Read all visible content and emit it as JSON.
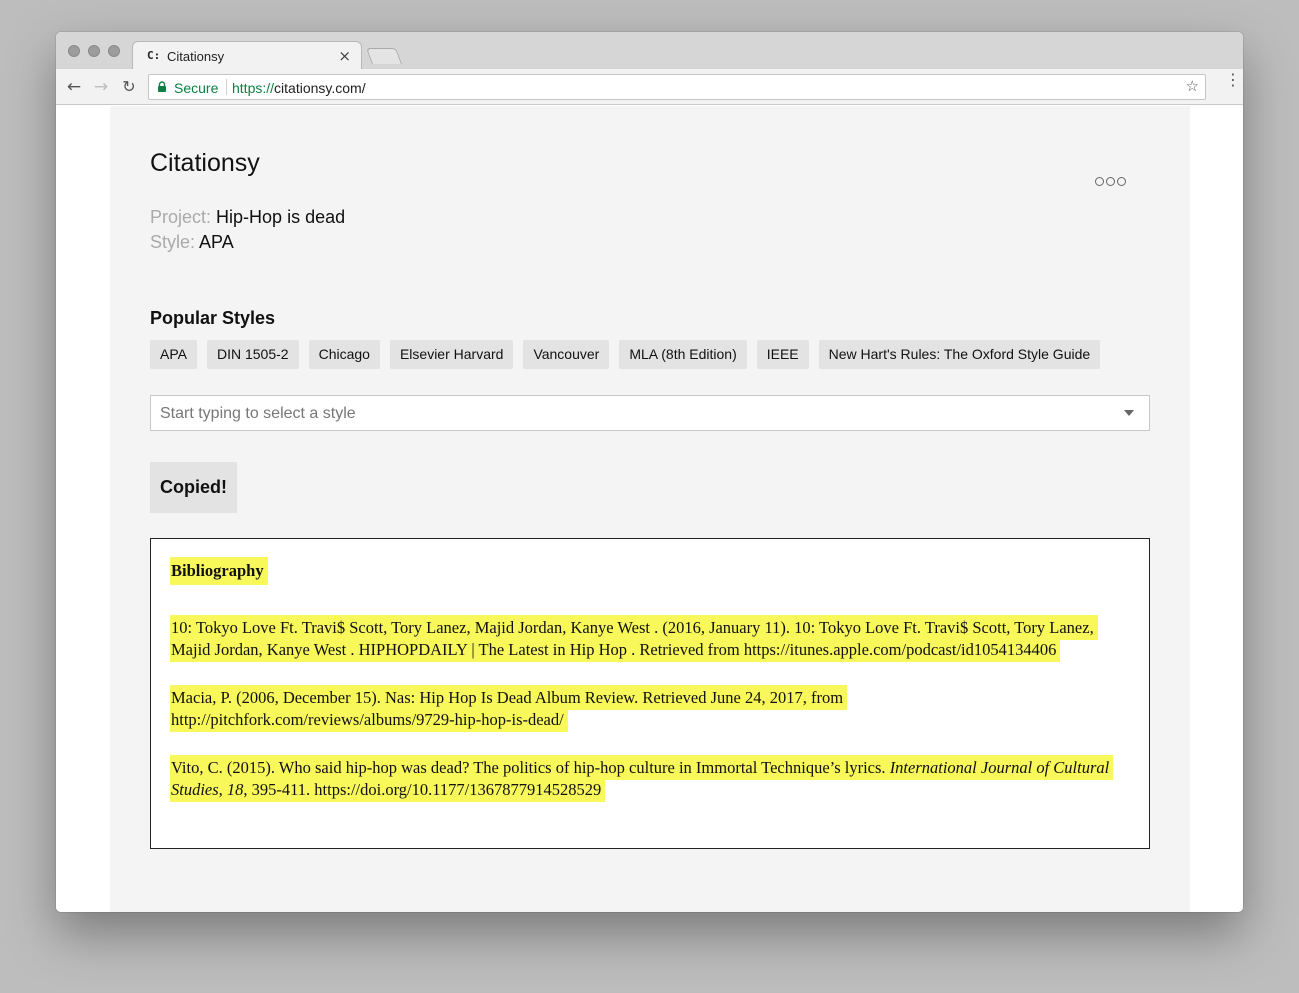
{
  "browser": {
    "tab_title": "Citationsy",
    "tab_favicon": "C:",
    "tab_close": "×",
    "secure_label": "Secure",
    "url_scheme": "https://",
    "url_rest": "citationsy.com/"
  },
  "icons": {
    "back": "←",
    "forward": "→",
    "reload": "↻",
    "star": "☆",
    "menu": "⋮"
  },
  "app": {
    "title": "Citationsy",
    "project_key": "Project:",
    "project_value": "Hip-Hop is dead",
    "style_key": "Style:",
    "style_value": "APA"
  },
  "popular": {
    "title": "Popular Styles",
    "styles": [
      "APA",
      "DIN 1505-2",
      "Chicago",
      "Elsevier Harvard",
      "Vancouver",
      "MLA (8th Edition)",
      "IEEE",
      "New Hart's Rules: The Oxford Style Guide"
    ]
  },
  "style_select": {
    "placeholder": "Start typing to select a style"
  },
  "copy_button": {
    "label": "Copied!"
  },
  "bibliography": {
    "heading": "Bibliography",
    "entries": [
      {
        "text": "10: Tokyo Love Ft. Travi$ Scott, Tory Lanez, Majid Jordan, Kanye West . (2016, January 11). 10: Tokyo Love Ft. Travi$ Scott, Tory Lanez, Majid Jordan, Kanye West . HIPHOPDAILY | The Latest in Hip Hop . Retrieved from https://itunes.apple.com/podcast/id1054134406"
      },
      {
        "text": "Macia, P. (2006, December 15). Nas: Hip Hop Is Dead Album Review. Retrieved June 24, 2017, from http://pitchfork.com/reviews/albums/9729-hip-hop-is-dead/"
      },
      {
        "pre": "Vito, C. (2015). Who said hip-hop was dead? The politics of hip-hop culture in Immortal Technique’s lyrics. ",
        "journal": "International Journal of Cultural Studies",
        "sep": ", ",
        "volume": "18",
        "post": ", 395-411. https://doi.org/10.1177/1367877914528529"
      }
    ]
  },
  "colors": {
    "highlight": "#f8f85b",
    "secure_green": "#0b8043",
    "page_bg": "#f4f4f4",
    "chip_bg": "#e3e3e3"
  }
}
